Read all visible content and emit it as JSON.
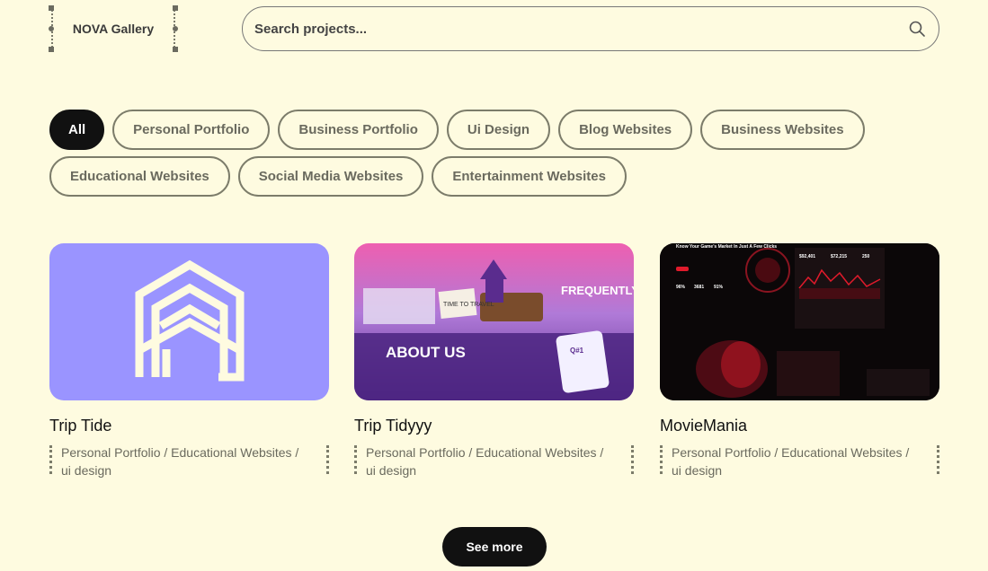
{
  "logo": {
    "text": "NOVA Gallery"
  },
  "search": {
    "placeholder": "Search projects...",
    "icon": "search-icon"
  },
  "filters": {
    "row1": [
      "All",
      "Personal Portfolio",
      "Business Portfolio",
      "Ui Design",
      "Blog Websites",
      "Business Websites"
    ],
    "row2": [
      "Educational Websites",
      "Social Media Websites",
      "Entertainment Websites"
    ],
    "active": "All"
  },
  "projects": [
    {
      "title": "Trip Tide",
      "tags": "Personal Portfolio / Educational Websites / ui design",
      "thumb_bg": "#9a94ff",
      "thumb_fg": "#fefbe0"
    },
    {
      "title": "Trip Tidyyy",
      "tags": "Personal Portfolio / Educational Websites / ui design",
      "thumb_text": {
        "faq": "FREQUENTLY QUESTIONS",
        "about": "ABOUT US",
        "travel": "TIME TO TRAVEL",
        "q": "Q#1"
      }
    },
    {
      "title": "MovieMania",
      "tags": "Personal Portfolio / Educational Websites / ui design",
      "thumb_text": {
        "headline": "Know Your Game's Market In Just A Few Clicks",
        "stat1": "$92,401",
        "stat2": "$72,215",
        "stat3": "250",
        "p1": "96%",
        "p2": "3681",
        "p3": "91%"
      }
    }
  ],
  "see_more": {
    "label": "See more"
  },
  "colors": {
    "background": "#fefbe0",
    "accent": "#111111",
    "card_purple": "#9a94ff"
  }
}
